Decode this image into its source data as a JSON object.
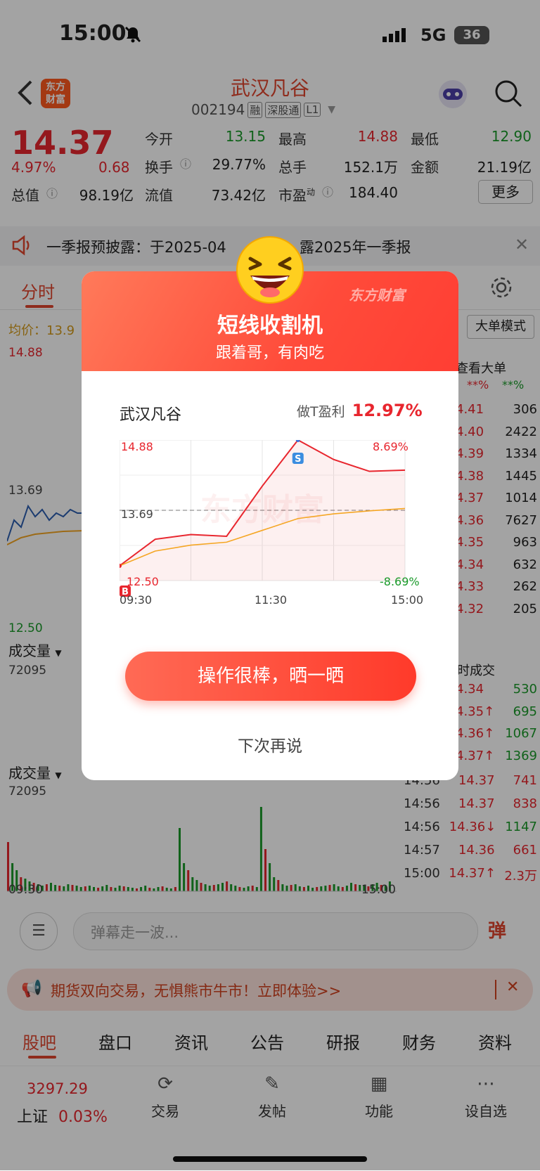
{
  "status": {
    "time": "15:00",
    "network": "5G",
    "battery": "36"
  },
  "nav": {
    "logo_line1": "东方",
    "logo_line2": "财富",
    "stock_name": "武汉凡谷",
    "stock_code": "002194",
    "badges": [
      "融",
      "深股通",
      "L1"
    ]
  },
  "quote": {
    "price": "14.37",
    "change_pct": "4.97%",
    "change": "0.68",
    "open_label": "今开",
    "open": "13.15",
    "high_label": "最高",
    "high": "14.88",
    "low_label": "最低",
    "low": "12.90",
    "turnover_label": "换手",
    "turnover": "29.77%",
    "volume_label": "总手",
    "volume": "152.1万",
    "amount_label": "金额",
    "amount": "21.19亿",
    "mktcap_label": "总值",
    "mktcap": "98.19亿",
    "float_label": "流值",
    "float": "73.42亿",
    "pe_label": "市盈",
    "pe_sup": "动",
    "pe": "184.40",
    "more": "更多"
  },
  "notice": {
    "text_a": "一季报预披露：于2025-04",
    "text_b": "露2025年一季报"
  },
  "tabs": {
    "active": "分时",
    "big_order": "大单模式"
  },
  "chart_bg": {
    "avg_label": "均价：13.9",
    "high": "14.88",
    "mid": "13.69",
    "low": "12.50",
    "vol_label": "成交量",
    "vol_max": "72095",
    "time_start": "09:30",
    "time_end": "15:00",
    "view_big_order": "查看大单",
    "hdr1": "**%",
    "hdr2": "**%",
    "order_book": [
      [
        "4.41",
        "306"
      ],
      [
        "4.40",
        "2422"
      ],
      [
        "4.39",
        "1334"
      ],
      [
        "4.38",
        "1445"
      ],
      [
        "4.37",
        "1014"
      ],
      [
        "4.36",
        "7627"
      ],
      [
        "4.35",
        "963"
      ],
      [
        "4.34",
        "632"
      ],
      [
        "4.33",
        "262"
      ],
      [
        "4.32",
        "205"
      ]
    ],
    "trades_header": "时成交",
    "trades_partial": [
      [
        "4.34",
        "530"
      ],
      [
        "4.35↑",
        "695"
      ],
      [
        "4.36↑",
        "1067"
      ],
      [
        "4.37↑",
        "1369"
      ]
    ],
    "trades": [
      [
        "14:56",
        "14.37",
        "741"
      ],
      [
        "14:56",
        "14.37",
        "838"
      ],
      [
        "14:56",
        "14.36↓",
        "1147"
      ],
      [
        "14:57",
        "14.36",
        "661"
      ],
      [
        "15:00",
        "14.37↑",
        "2.3万"
      ]
    ]
  },
  "comment": {
    "placeholder": "弹幕走一波...",
    "danmu": "弹"
  },
  "ad": {
    "text": "期货双向交易，无惧熊市牛市！立即体验>>"
  },
  "bottom_tabs": [
    "股吧",
    "盘口",
    "资讯",
    "公告",
    "研报",
    "财务",
    "资料"
  ],
  "bottombar": {
    "index_value": "3297.29",
    "index_name": "上证",
    "index_change": "0.03%",
    "trade": "交易",
    "post": "发帖",
    "func": "功能",
    "watch": "设自选"
  },
  "modal": {
    "brand": "东方财富",
    "title": "短线收割机",
    "subtitle": "跟着哥，有肉吃",
    "stock": "武汉凡谷",
    "profit_label": "做T盈利",
    "profit_value": "12.97%",
    "chart_high": "14.88",
    "chart_high_pct": "8.69%",
    "chart_mid": "13.69",
    "chart_low": "12.50",
    "chart_low_pct": "-8.69%",
    "x_start": "09:30",
    "x_mid": "11:30",
    "x_end": "15:00",
    "buy_marker": "B",
    "sell_marker": "S",
    "watermark": "东方财富",
    "share_button": "操作很棒，晒一晒",
    "later": "下次再说"
  },
  "chart_data": {
    "type": "line",
    "title": "",
    "x": [
      "09:30",
      "10:00",
      "10:30",
      "11:00",
      "11:30",
      "13:30",
      "14:00",
      "14:30",
      "15:00"
    ],
    "series": [
      {
        "name": "",
        "values": [
          12.75,
          13.2,
          13.28,
          13.25,
          14.1,
          14.88,
          14.55,
          14.35,
          14.37
        ],
        "color": "#e8262e"
      },
      {
        "name": "",
        "values": [
          12.75,
          13.0,
          13.1,
          13.15,
          13.35,
          13.55,
          13.63,
          13.68,
          13.72
        ],
        "color": "#f5a623"
      }
    ],
    "ylim": [
      12.5,
      14.88
    ],
    "reference_line": 13.69,
    "markers": [
      {
        "label": "B",
        "x": "09:30",
        "y": 12.75
      },
      {
        "label": "S",
        "x": "13:30",
        "y": 14.88
      }
    ]
  }
}
